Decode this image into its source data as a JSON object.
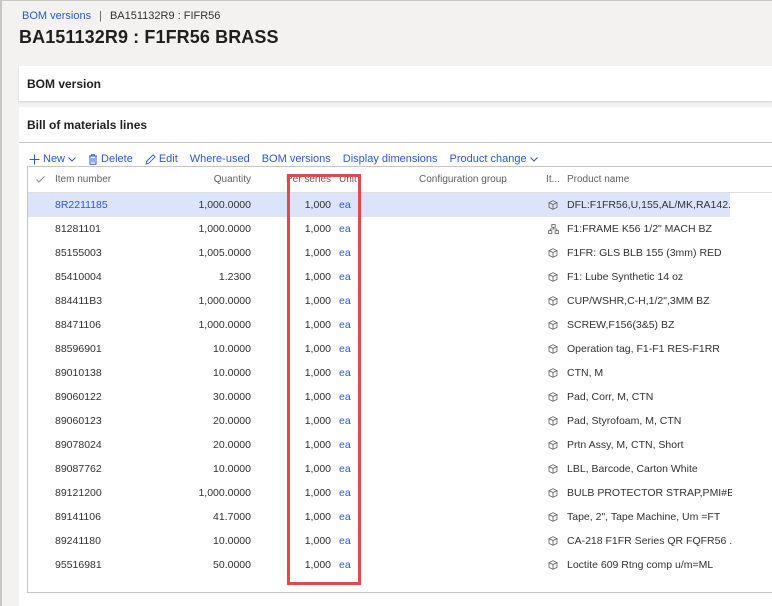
{
  "breadcrumb": {
    "link": "BOM versions",
    "separator": "|",
    "current": "BA151132R9 : FIFR56"
  },
  "page_title": "BA151132R9 : F1FR56 BRASS",
  "bom_version_section": {
    "title": "BOM version"
  },
  "lines_section": {
    "title": "Bill of materials lines",
    "toolbar": {
      "new": "New",
      "delete": "Delete",
      "edit": "Edit",
      "where_used": "Where-used",
      "bom_versions": "BOM versions",
      "display_dimensions": "Display dimensions",
      "product_change": "Product change"
    },
    "columns": {
      "check": "✓",
      "item_number": "Item number",
      "quantity": "Quantity",
      "per_series": "Per series",
      "unit": "Unit",
      "configuration_group": "Configuration group",
      "item_type": "It...",
      "product_name": "Product name"
    },
    "rows": [
      {
        "item": "8R2211185",
        "qty": "1,000.0000",
        "per": "1,000",
        "unit": "ea",
        "cfg": "",
        "icon": "item-icon",
        "name": "DFL:F1FR56,U,155,AL/MK,RA142...",
        "selected": true
      },
      {
        "item": "81281101",
        "qty": "1,000.0000",
        "per": "1,000",
        "unit": "ea",
        "cfg": "",
        "icon": "bom-icon",
        "name": "F1:FRAME K56 1/2\" MACH BZ"
      },
      {
        "item": "85155003",
        "qty": "1,005.0000",
        "per": "1,000",
        "unit": "ea",
        "cfg": "",
        "icon": "item-icon",
        "name": "F1FR: GLS BLB 155 (3mm) RED"
      },
      {
        "item": "85410004",
        "qty": "1.2300",
        "per": "1,000",
        "unit": "ea",
        "cfg": "",
        "icon": "item-icon",
        "name": "F1: Lube Synthetic 14 oz"
      },
      {
        "item": "884411B3",
        "qty": "1,000.0000",
        "per": "1,000",
        "unit": "ea",
        "cfg": "",
        "icon": "item-icon",
        "name": "CUP/WSHR,C-H,1/2\",3MM BZ"
      },
      {
        "item": "88471106",
        "qty": "1,000.0000",
        "per": "1,000",
        "unit": "ea",
        "cfg": "",
        "icon": "item-icon",
        "name": "SCREW,F156(3&5) BZ"
      },
      {
        "item": "88596901",
        "qty": "10.0000",
        "per": "1,000",
        "unit": "ea",
        "cfg": "",
        "icon": "item-icon",
        "name": "Operation tag, F1-F1 RES-F1RR"
      },
      {
        "item": "89010138",
        "qty": "10.0000",
        "per": "1,000",
        "unit": "ea",
        "cfg": "",
        "icon": "item-icon",
        "name": "CTN, M"
      },
      {
        "item": "89060122",
        "qty": "30.0000",
        "per": "1,000",
        "unit": "ea",
        "cfg": "",
        "icon": "item-icon",
        "name": "Pad, Corr, M, CTN"
      },
      {
        "item": "89060123",
        "qty": "20.0000",
        "per": "1,000",
        "unit": "ea",
        "cfg": "",
        "icon": "item-icon",
        "name": "Pad, Styrofoam, M, CTN"
      },
      {
        "item": "89078024",
        "qty": "20.0000",
        "per": "1,000",
        "unit": "ea",
        "cfg": "",
        "icon": "item-icon",
        "name": "Prtn Assy, M, CTN, Short"
      },
      {
        "item": "89087762",
        "qty": "10.0000",
        "per": "1,000",
        "unit": "ea",
        "cfg": "",
        "icon": "item-icon",
        "name": "LBL, Barcode, Carton White"
      },
      {
        "item": "89121200",
        "qty": "1,000.0000",
        "per": "1,000",
        "unit": "ea",
        "cfg": "",
        "icon": "item-icon",
        "name": "BULB PROTECTOR STRAP,PMI#B..."
      },
      {
        "item": "89141106",
        "qty": "41.7000",
        "per": "1,000",
        "unit": "ea",
        "cfg": "",
        "icon": "item-icon",
        "name": "Tape, 2\", Tape Machine, Um =FT"
      },
      {
        "item": "89241180",
        "qty": "10.0000",
        "per": "1,000",
        "unit": "ea",
        "cfg": "",
        "icon": "item-icon",
        "name": "CA-218 F1FR Series QR FQFR56 ..."
      },
      {
        "item": "95516981",
        "qty": "50.0000",
        "per": "1,000",
        "unit": "ea",
        "cfg": "",
        "icon": "item-icon",
        "name": "Loctite 609 Rtng comp u/m=ML"
      }
    ]
  },
  "colors": {
    "accent": "#2b57d1",
    "selected_row": "#dbe4fb",
    "highlight_box": "#e04a4a"
  }
}
